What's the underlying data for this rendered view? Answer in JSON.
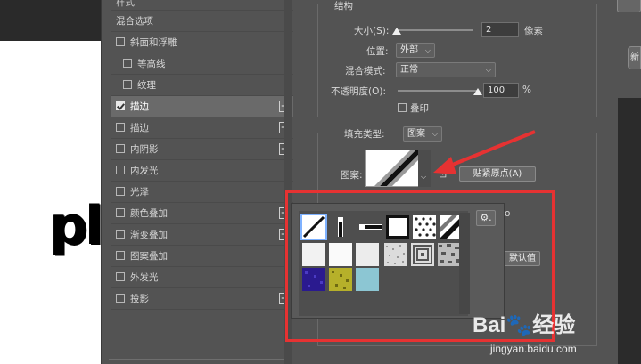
{
  "canvas": {
    "text": "pl"
  },
  "styles_panel": {
    "header": "样式",
    "blend_options": "混合选项",
    "items": [
      {
        "label": "斜面和浮雕",
        "checked": false,
        "sub": false,
        "plus": false
      },
      {
        "label": "等高线",
        "checked": false,
        "sub": true,
        "plus": false
      },
      {
        "label": "纹理",
        "checked": false,
        "sub": true,
        "plus": false
      },
      {
        "label": "描边",
        "checked": true,
        "sub": false,
        "plus": true,
        "active": true
      },
      {
        "label": "描边",
        "checked": false,
        "sub": false,
        "plus": true
      },
      {
        "label": "内阴影",
        "checked": false,
        "sub": false,
        "plus": true
      },
      {
        "label": "内发光",
        "checked": false,
        "sub": false,
        "plus": false
      },
      {
        "label": "光泽",
        "checked": false,
        "sub": false,
        "plus": false
      },
      {
        "label": "颜色叠加",
        "checked": false,
        "sub": false,
        "plus": true
      },
      {
        "label": "渐变叠加",
        "checked": false,
        "sub": false,
        "plus": true
      },
      {
        "label": "图案叠加",
        "checked": false,
        "sub": false,
        "plus": false
      },
      {
        "label": "外发光",
        "checked": false,
        "sub": false,
        "plus": false
      },
      {
        "label": "投影",
        "checked": false,
        "sub": false,
        "plus": true
      }
    ]
  },
  "structure": {
    "title": "结构",
    "size_label": "大小(S):",
    "size_value": "2",
    "size_unit": "像素",
    "size_level": 0.02,
    "position_label": "位置:",
    "position_value": "外部",
    "blend_label": "混合模式:",
    "blend_value": "正常",
    "opacity_label": "不透明度(O):",
    "opacity_value": "100",
    "opacity_unit": "%",
    "opacity_level": 1.0,
    "emboss_label": "叠印"
  },
  "fill": {
    "type_label": "填充类型:",
    "type_value": "图案",
    "pattern_label": "图案:",
    "snap_button": "贴紧原点(A)",
    "default_button_partial": "默认值",
    "link_partial": "o"
  },
  "popup": {
    "gear_label": "⚙."
  },
  "icons": {
    "chevron": "chevron-down-icon",
    "gear": "gear-icon",
    "link": "link-icon"
  },
  "colors": {
    "highlight": "#e63232",
    "selection": "#7fb2ff"
  },
  "watermark": {
    "brand": "Bai",
    "brand2": "经验",
    "url": "jingyan.baidu.com"
  }
}
